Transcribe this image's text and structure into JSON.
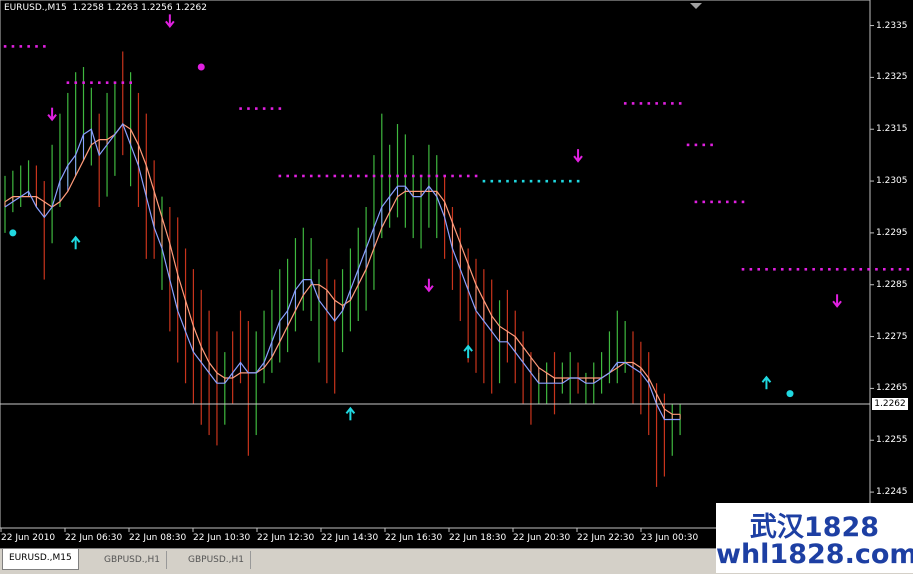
{
  "chart_header": "EURUSD.,M15  1.2258 1.2263 1.2256 1.2262",
  "current_price": "1.2262",
  "colors": {
    "bull": "#3fb83f",
    "bear": "#c8341c",
    "ma_fast": "#8aa0ff",
    "ma_slow": "#ff9a7a",
    "dots": "#e020e0",
    "signal": "#20d8e0",
    "grid_line": "#c8c8c8"
  },
  "tabs": [
    {
      "label": "EURUSD.,M15",
      "active": true
    },
    {
      "label": "GBPUSD.,H1",
      "active": false
    },
    {
      "label": "GBPUSD.,H1",
      "active": false
    }
  ],
  "watermark": {
    "line1": "武汉1828",
    "line2": "whl1828.com"
  },
  "chart_data": {
    "type": "candlestick",
    "price_ticks": [
      "1.2335",
      "1.2325",
      "1.2315",
      "1.2305",
      "1.2295",
      "1.2285",
      "1.2275",
      "1.2265",
      "1.2255",
      "1.2245"
    ],
    "time_ticks": [
      "22 Jun 2010",
      "22 Jun 06:30",
      "22 Jun 08:30",
      "22 Jun 10:30",
      "22 Jun 12:30",
      "22 Jun 14:30",
      "22 Jun 16:30",
      "22 Jun 18:30",
      "22 Jun 20:30",
      "22 Jun 22:30",
      "23 Jun 00:30"
    ],
    "ylim": [
      1.224,
      1.2338
    ],
    "bars": [
      {
        "h": 1.2306,
        "l": 1.2295,
        "c": "bull"
      },
      {
        "h": 1.2307,
        "l": 1.2299,
        "c": "bull"
      },
      {
        "h": 1.2308,
        "l": 1.23,
        "c": "bull"
      },
      {
        "h": 1.2309,
        "l": 1.2302,
        "c": "bull"
      },
      {
        "h": 1.2308,
        "l": 1.23,
        "c": "bear"
      },
      {
        "h": 1.2305,
        "l": 1.2286,
        "c": "bear"
      },
      {
        "h": 1.2312,
        "l": 1.2293,
        "c": "bull"
      },
      {
        "h": 1.2318,
        "l": 1.23,
        "c": "bull"
      },
      {
        "h": 1.2322,
        "l": 1.2304,
        "c": "bull"
      },
      {
        "h": 1.2326,
        "l": 1.2306,
        "c": "bull"
      },
      {
        "h": 1.2327,
        "l": 1.2309,
        "c": "bull"
      },
      {
        "h": 1.2323,
        "l": 1.2308,
        "c": "bull"
      },
      {
        "h": 1.2318,
        "l": 1.23,
        "c": "bear"
      },
      {
        "h": 1.2322,
        "l": 1.2302,
        "c": "bull"
      },
      {
        "h": 1.2324,
        "l": 1.2306,
        "c": "bull"
      },
      {
        "h": 1.233,
        "l": 1.231,
        "c": "bear"
      },
      {
        "h": 1.2326,
        "l": 1.2304,
        "c": "bull"
      },
      {
        "h": 1.2322,
        "l": 1.23,
        "c": "bear"
      },
      {
        "h": 1.2318,
        "l": 1.229,
        "c": "bear"
      },
      {
        "h": 1.2309,
        "l": 1.229,
        "c": "bear"
      },
      {
        "h": 1.2302,
        "l": 1.2284,
        "c": "bull"
      },
      {
        "h": 1.23,
        "l": 1.2276,
        "c": "bear"
      },
      {
        "h": 1.2298,
        "l": 1.227,
        "c": "bear"
      },
      {
        "h": 1.2292,
        "l": 1.2266,
        "c": "bear"
      },
      {
        "h": 1.2288,
        "l": 1.2262,
        "c": "bear"
      },
      {
        "h": 1.2284,
        "l": 1.2258,
        "c": "bear"
      },
      {
        "h": 1.228,
        "l": 1.2256,
        "c": "bear"
      },
      {
        "h": 1.2276,
        "l": 1.2254,
        "c": "bear"
      },
      {
        "h": 1.2272,
        "l": 1.2258,
        "c": "bull"
      },
      {
        "h": 1.2276,
        "l": 1.2262,
        "c": "bear"
      },
      {
        "h": 1.228,
        "l": 1.2266,
        "c": "bear"
      },
      {
        "h": 1.2278,
        "l": 1.2252,
        "c": "bear"
      },
      {
        "h": 1.2276,
        "l": 1.2256,
        "c": "bull"
      },
      {
        "h": 1.228,
        "l": 1.2266,
        "c": "bull"
      },
      {
        "h": 1.2284,
        "l": 1.2268,
        "c": "bull"
      },
      {
        "h": 1.2288,
        "l": 1.227,
        "c": "bull"
      },
      {
        "h": 1.229,
        "l": 1.2272,
        "c": "bull"
      },
      {
        "h": 1.2294,
        "l": 1.2276,
        "c": "bull"
      },
      {
        "h": 1.2296,
        "l": 1.228,
        "c": "bull"
      },
      {
        "h": 1.2294,
        "l": 1.2278,
        "c": "bull"
      },
      {
        "h": 1.2288,
        "l": 1.227,
        "c": "bull"
      },
      {
        "h": 1.229,
        "l": 1.2266,
        "c": "bear"
      },
      {
        "h": 1.2286,
        "l": 1.2264,
        "c": "bear"
      },
      {
        "h": 1.2288,
        "l": 1.2272,
        "c": "bull"
      },
      {
        "h": 1.2292,
        "l": 1.2276,
        "c": "bull"
      },
      {
        "h": 1.2296,
        "l": 1.2278,
        "c": "bull"
      },
      {
        "h": 1.23,
        "l": 1.228,
        "c": "bull"
      },
      {
        "h": 1.231,
        "l": 1.2284,
        "c": "bull"
      },
      {
        "h": 1.2318,
        "l": 1.2294,
        "c": "bull"
      },
      {
        "h": 1.2312,
        "l": 1.2296,
        "c": "bull"
      },
      {
        "h": 1.2316,
        "l": 1.2298,
        "c": "bull"
      },
      {
        "h": 1.2314,
        "l": 1.2296,
        "c": "bull"
      },
      {
        "h": 1.231,
        "l": 1.2294,
        "c": "bull"
      },
      {
        "h": 1.2306,
        "l": 1.2292,
        "c": "bull"
      },
      {
        "h": 1.2312,
        "l": 1.2296,
        "c": "bull"
      },
      {
        "h": 1.231,
        "l": 1.2294,
        "c": "bull"
      },
      {
        "h": 1.2306,
        "l": 1.229,
        "c": "bear"
      },
      {
        "h": 1.23,
        "l": 1.2284,
        "c": "bear"
      },
      {
        "h": 1.2296,
        "l": 1.2278,
        "c": "bear"
      },
      {
        "h": 1.2292,
        "l": 1.227,
        "c": "bear"
      },
      {
        "h": 1.229,
        "l": 1.2268,
        "c": "bear"
      },
      {
        "h": 1.2288,
        "l": 1.2266,
        "c": "bear"
      },
      {
        "h": 1.2286,
        "l": 1.2264,
        "c": "bear"
      },
      {
        "h": 1.2282,
        "l": 1.2266,
        "c": "bull"
      },
      {
        "h": 1.2284,
        "l": 1.227,
        "c": "bear"
      },
      {
        "h": 1.228,
        "l": 1.2266,
        "c": "bear"
      },
      {
        "h": 1.2276,
        "l": 1.2262,
        "c": "bear"
      },
      {
        "h": 1.2272,
        "l": 1.2258,
        "c": "bear"
      },
      {
        "h": 1.2268,
        "l": 1.2262,
        "c": "bull"
      },
      {
        "h": 1.227,
        "l": 1.2262,
        "c": "bull"
      },
      {
        "h": 1.2272,
        "l": 1.226,
        "c": "bear"
      },
      {
        "h": 1.227,
        "l": 1.2264,
        "c": "bull"
      },
      {
        "h": 1.2272,
        "l": 1.2262,
        "c": "bull"
      },
      {
        "h": 1.227,
        "l": 1.2264,
        "c": "bear"
      },
      {
        "h": 1.2268,
        "l": 1.2262,
        "c": "bull"
      },
      {
        "h": 1.227,
        "l": 1.2262,
        "c": "bull"
      },
      {
        "h": 1.2272,
        "l": 1.2264,
        "c": "bull"
      },
      {
        "h": 1.2276,
        "l": 1.2266,
        "c": "bull"
      },
      {
        "h": 1.228,
        "l": 1.2266,
        "c": "bull"
      },
      {
        "h": 1.2278,
        "l": 1.2268,
        "c": "bull"
      },
      {
        "h": 1.2276,
        "l": 1.2262,
        "c": "bear"
      },
      {
        "h": 1.2274,
        "l": 1.226,
        "c": "bear"
      },
      {
        "h": 1.2272,
        "l": 1.2256,
        "c": "bear"
      },
      {
        "h": 1.2266,
        "l": 1.2246,
        "c": "bear"
      },
      {
        "h": 1.2264,
        "l": 1.2248,
        "c": "bear"
      },
      {
        "h": 1.2262,
        "l": 1.2252,
        "c": "bull"
      },
      {
        "h": 1.2262,
        "l": 1.2256,
        "c": "bull"
      }
    ],
    "ma_fast": [
      1.23,
      1.2301,
      1.2302,
      1.2303,
      1.23,
      1.2298,
      1.23,
      1.2305,
      1.2308,
      1.231,
      1.2314,
      1.2315,
      1.231,
      1.2312,
      1.2314,
      1.2316,
      1.2312,
      1.2308,
      1.2302,
      1.2296,
      1.2292,
      1.2286,
      1.228,
      1.2276,
      1.2272,
      1.227,
      1.2268,
      1.2266,
      1.2266,
      1.2268,
      1.227,
      1.2268,
      1.2268,
      1.227,
      1.2274,
      1.2278,
      1.228,
      1.2284,
      1.2286,
      1.2286,
      1.2282,
      1.228,
      1.2278,
      1.228,
      1.2284,
      1.2288,
      1.2292,
      1.2296,
      1.23,
      1.2302,
      1.2304,
      1.2304,
      1.2302,
      1.2302,
      1.2304,
      1.2302,
      1.2298,
      1.2292,
      1.2288,
      1.2284,
      1.228,
      1.2278,
      1.2276,
      1.2274,
      1.2274,
      1.2272,
      1.227,
      1.2268,
      1.2266,
      1.2266,
      1.2266,
      1.2266,
      1.2267,
      1.2267,
      1.2266,
      1.2266,
      1.2267,
      1.2268,
      1.227,
      1.227,
      1.2269,
      1.2268,
      1.2266,
      1.2262,
      1.2259,
      1.2259,
      1.2259
    ],
    "ma_slow": [
      1.2301,
      1.2302,
      1.2302,
      1.2302,
      1.2302,
      1.2301,
      1.23,
      1.2301,
      1.2303,
      1.2306,
      1.2309,
      1.2312,
      1.2313,
      1.2313,
      1.2314,
      1.2316,
      1.2315,
      1.2312,
      1.2308,
      1.2303,
      1.2298,
      1.2293,
      1.2287,
      1.2282,
      1.2277,
      1.2273,
      1.227,
      1.2268,
      1.2267,
      1.2267,
      1.2268,
      1.2268,
      1.2268,
      1.2269,
      1.2271,
      1.2274,
      1.2277,
      1.228,
      1.2283,
      1.2285,
      1.2285,
      1.2284,
      1.2282,
      1.2281,
      1.2282,
      1.2285,
      1.2288,
      1.2292,
      1.2296,
      1.2299,
      1.2302,
      1.2303,
      1.2303,
      1.2303,
      1.2303,
      1.2303,
      1.2301,
      1.2297,
      1.2293,
      1.2289,
      1.2285,
      1.2282,
      1.2279,
      1.2277,
      1.2276,
      1.2275,
      1.2273,
      1.2271,
      1.2269,
      1.2268,
      1.2267,
      1.2267,
      1.2267,
      1.2267,
      1.2267,
      1.2267,
      1.2267,
      1.2268,
      1.2269,
      1.227,
      1.227,
      1.2269,
      1.2267,
      1.2264,
      1.2261,
      1.226,
      1.226
    ],
    "dot_segments": [
      {
        "x0": 0,
        "x1": 5,
        "y": 1.2331,
        "color": "#e020e0"
      },
      {
        "x0": 8,
        "x1": 16,
        "y": 1.2324,
        "color": "#e020e0"
      },
      {
        "x0": 30,
        "x1": 35,
        "y": 1.2319,
        "color": "#e020e0"
      },
      {
        "x0": 35,
        "x1": 60,
        "y": 1.2306,
        "color": "#e020e0"
      },
      {
        "x0": 61,
        "x1": 73,
        "y": 1.2305,
        "color": "#20d8e0"
      },
      {
        "x0": 79,
        "x1": 86,
        "y": 1.232,
        "color": "#e020e0"
      },
      {
        "x0": 87,
        "x1": 90,
        "y": 1.2312,
        "color": "#e020e0"
      },
      {
        "x0": 88,
        "x1": 94,
        "y": 1.2301,
        "color": "#e020e0"
      },
      {
        "x0": 94,
        "x1": 118,
        "y": 1.2288,
        "color": "#e020e0"
      }
    ],
    "signals": [
      {
        "i": 6,
        "y": 1.2318,
        "kind": "down",
        "color": "#e020e0"
      },
      {
        "i": 9,
        "y": 1.2293,
        "kind": "up",
        "color": "#20d8e0"
      },
      {
        "i": 21,
        "y": 1.2336,
        "kind": "down",
        "color": "#e020e0"
      },
      {
        "i": 44,
        "y": 1.226,
        "kind": "up",
        "color": "#20d8e0"
      },
      {
        "i": 54,
        "y": 1.2285,
        "kind": "down",
        "color": "#e020e0"
      },
      {
        "i": 59,
        "y": 1.2272,
        "kind": "up",
        "color": "#20d8e0"
      },
      {
        "i": 73,
        "y": 1.231,
        "kind": "down",
        "color": "#e020e0"
      },
      {
        "i": 97,
        "y": 1.2266,
        "kind": "up",
        "color": "#20d8e0"
      },
      {
        "i": 106,
        "y": 1.2282,
        "kind": "down",
        "color": "#e020e0"
      }
    ],
    "circles": [
      {
        "i": 1,
        "y": 1.2295,
        "color": "#20d8e0"
      },
      {
        "i": 25,
        "y": 1.2327,
        "color": "#e020e0"
      },
      {
        "i": 100,
        "y": 1.2264,
        "color": "#20d8e0"
      }
    ]
  }
}
